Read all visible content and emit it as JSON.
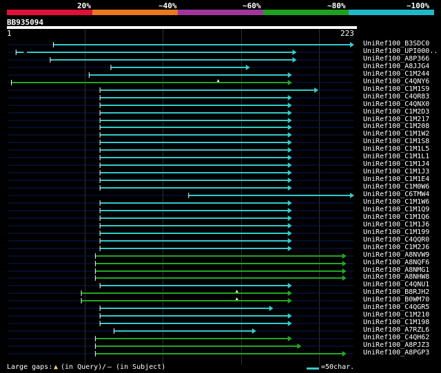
{
  "header": {
    "percent_labels": [
      "20%",
      "~40%",
      "~60%",
      "~80%",
      "~100%"
    ],
    "color_segments": [
      "#e0103a",
      "#e8791e",
      "#a0359c",
      "#1fa01f",
      "#1fb8c8"
    ],
    "query_id": "BB935094",
    "ruler_start": "1",
    "ruler_end": "223"
  },
  "colors": {
    "cyan": "#33cccc",
    "green": "#22aa22",
    "connector": "#0a1a5a",
    "grid": "#2f2f2f"
  },
  "query_length": 223,
  "hits": [
    {
      "name": "UniRef100_B3SDC0",
      "start": 30,
      "end": 223,
      "color": "cyan",
      "arrow": true
    },
    {
      "name": "UniRef100_UPI000..",
      "start": 6,
      "end": 186,
      "color": "cyan",
      "arrow": true,
      "gap_from": 11,
      "gap_to": 13
    },
    {
      "name": "UniRef100_A8P366",
      "start": 28,
      "end": 186,
      "color": "cyan",
      "arrow": true
    },
    {
      "name": "UniRef100_A8JJG4",
      "start": 67,
      "end": 156,
      "color": "cyan",
      "arrow": true
    },
    {
      "name": "UniRef100_C1M244",
      "start": 53,
      "end": 183,
      "color": "cyan",
      "arrow": true
    },
    {
      "name": "UniRef100_C4QNY6",
      "start": 3,
      "end": 183,
      "color": "green",
      "arrow": true,
      "marker": 136
    },
    {
      "name": "UniRef100_C1M1S9",
      "start": 60,
      "end": 200,
      "color": "cyan",
      "arrow": true
    },
    {
      "name": "UniRef100_C4QR83",
      "start": 60,
      "end": 183,
      "color": "cyan",
      "arrow": true
    },
    {
      "name": "UniRef100_C4QNX0",
      "start": 60,
      "end": 183,
      "color": "cyan",
      "arrow": true
    },
    {
      "name": "UniRef100_C1M2D3",
      "start": 60,
      "end": 183,
      "color": "cyan",
      "arrow": true
    },
    {
      "name": "UniRef100_C1M217",
      "start": 60,
      "end": 183,
      "color": "cyan",
      "arrow": true
    },
    {
      "name": "UniRef100_C1M208",
      "start": 60,
      "end": 183,
      "color": "cyan",
      "arrow": true
    },
    {
      "name": "UniRef100_C1M1W2",
      "start": 60,
      "end": 183,
      "color": "cyan",
      "arrow": true
    },
    {
      "name": "UniRef100_C1M1S8",
      "start": 60,
      "end": 183,
      "color": "cyan",
      "arrow": true
    },
    {
      "name": "UniRef100_C1M1L5",
      "start": 60,
      "end": 183,
      "color": "cyan",
      "arrow": true
    },
    {
      "name": "UniRef100_C1M1L1",
      "start": 60,
      "end": 183,
      "color": "cyan",
      "arrow": true
    },
    {
      "name": "UniRef100_C1M1J4",
      "start": 60,
      "end": 183,
      "color": "cyan",
      "arrow": true
    },
    {
      "name": "UniRef100_C1M1J3",
      "start": 60,
      "end": 183,
      "color": "cyan",
      "arrow": true
    },
    {
      "name": "UniRef100_C1M1E4",
      "start": 60,
      "end": 183,
      "color": "cyan",
      "arrow": true
    },
    {
      "name": "UniRef100_C1M0W6",
      "start": 60,
      "end": 183,
      "color": "cyan",
      "arrow": true
    },
    {
      "name": "UniRef100_C6TMW4",
      "start": 117,
      "end": 223,
      "color": "cyan",
      "arrow": true
    },
    {
      "name": "UniRef100_C1M1W6",
      "start": 60,
      "end": 183,
      "color": "cyan",
      "arrow": true
    },
    {
      "name": "UniRef100_C1M1Q9",
      "start": 60,
      "end": 183,
      "color": "cyan",
      "arrow": true
    },
    {
      "name": "UniRef100_C1M1Q6",
      "start": 60,
      "end": 183,
      "color": "cyan",
      "arrow": true
    },
    {
      "name": "UniRef100_C1M1J6",
      "start": 60,
      "end": 183,
      "color": "cyan",
      "arrow": true
    },
    {
      "name": "UniRef100_C1M199",
      "start": 60,
      "end": 183,
      "color": "cyan",
      "arrow": true
    },
    {
      "name": "UniRef100_C4QQR0",
      "start": 60,
      "end": 183,
      "color": "cyan",
      "arrow": true
    },
    {
      "name": "UniRef100_C1M2J6",
      "start": 60,
      "end": 183,
      "color": "cyan",
      "arrow": true
    },
    {
      "name": "UniRef100_A8NVW9",
      "start": 57,
      "end": 218,
      "color": "green",
      "arrow": true
    },
    {
      "name": "UniRef100_A8NQF6",
      "start": 57,
      "end": 218,
      "color": "green",
      "arrow": true
    },
    {
      "name": "UniRef100_A8NMG1",
      "start": 57,
      "end": 218,
      "color": "green",
      "arrow": true
    },
    {
      "name": "UniRef100_A8NHW8",
      "start": 57,
      "end": 218,
      "color": "green",
      "arrow": true
    },
    {
      "name": "UniRef100_C4QNU1",
      "start": 60,
      "end": 183,
      "color": "cyan",
      "arrow": true
    },
    {
      "name": "UniRef100_B8RJH2",
      "start": 48,
      "end": 183,
      "color": "green",
      "arrow": true,
      "marker": 148
    },
    {
      "name": "UniRef100_B0WM70",
      "start": 48,
      "end": 183,
      "color": "green",
      "arrow": true,
      "marker": 148
    },
    {
      "name": "UniRef100_C4QGR5",
      "start": 60,
      "end": 171,
      "color": "cyan",
      "arrow": true
    },
    {
      "name": "UniRef100_C1M210",
      "start": 60,
      "end": 183,
      "color": "cyan",
      "arrow": true
    },
    {
      "name": "UniRef100_C1M198",
      "start": 60,
      "end": 183,
      "color": "cyan",
      "arrow": true
    },
    {
      "name": "UniRef100_A7RZL6",
      "start": 69,
      "end": 160,
      "color": "cyan",
      "arrow": true
    },
    {
      "name": "UniRef100_C4QH62",
      "start": 57,
      "end": 183,
      "color": "green",
      "arrow": true
    },
    {
      "name": "UniRef100_A8PJZ3",
      "start": 57,
      "end": 189,
      "color": "green",
      "arrow": true
    },
    {
      "name": "UniRef100_A8PGP3",
      "start": 57,
      "end": 218,
      "color": "green",
      "arrow": true
    }
  ],
  "footer": {
    "large_gaps_label": "Large gaps:",
    "gap_query_symbol": "▲",
    "gap_query_text": "(in Query)",
    "gap_subject_symbol": "/",
    "gap_subject_text": "– (in Subject)",
    "scale_text": "=50char."
  }
}
